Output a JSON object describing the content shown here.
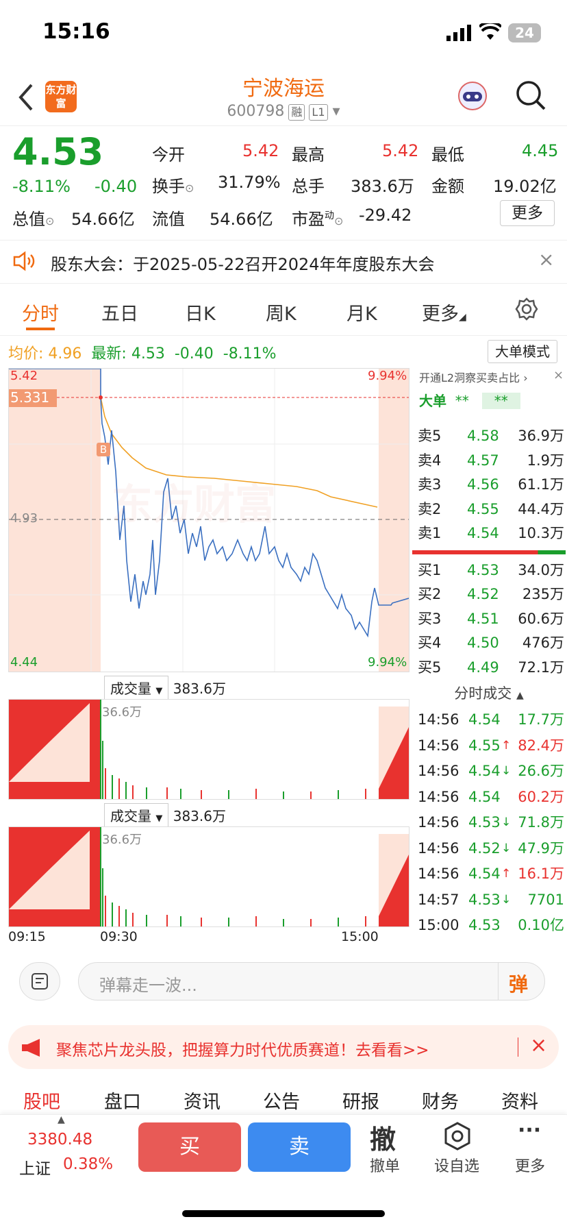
{
  "status": {
    "time": "15:16",
    "battery": "24"
  },
  "header": {
    "title": "宁波海运",
    "code": "600798",
    "tag1": "融",
    "tag2": "L1",
    "logo": "东方财富"
  },
  "quote": {
    "price": "4.53",
    "pct": "-8.11%",
    "chg": "-0.40",
    "open_l": "今开",
    "open": "5.42",
    "high_l": "最高",
    "high": "5.42",
    "low_l": "最低",
    "low": "4.45",
    "turn_l": "换手",
    "turn": "31.79%",
    "vol_l": "总手",
    "vol": "383.6万",
    "amt_l": "金额",
    "amt": "19.02亿",
    "mcap_l": "总值",
    "mcap": "54.66亿",
    "float_l": "流值",
    "float": "54.66亿",
    "pe_l": "市盈",
    "pe_sup": "动",
    "pe": "-29.42",
    "more": "更多"
  },
  "notice": {
    "text": "股东大会：于2025-05-22召开2024年年度股东大会"
  },
  "tabs": [
    "分时",
    "五日",
    "日K",
    "周K",
    "月K",
    "更多"
  ],
  "info": {
    "avg_l": "均价:",
    "avg": "4.96",
    "last_l": "最新:",
    "last": "4.53",
    "chg": "-0.40",
    "pct": "-8.11%",
    "mode": "大单模式"
  },
  "chart": {
    "y_top": "5.42",
    "y_mid": "4.93",
    "y_bot": "4.44",
    "pct_top": "9.94%",
    "pct_bot": "9.94%",
    "ref": "5.331",
    "marker": "B",
    "watermark": "东方财富",
    "x_start": "09:15",
    "x_mid": "09:30",
    "x_end": "15:00"
  },
  "volume": {
    "label": "成交量",
    "total": "383.6万",
    "peak": "36.6万"
  },
  "side": {
    "l2": "开通L2洞察买卖占比",
    "big": "大单",
    "stars1": "**",
    "stars2": "**",
    "asks": [
      {
        "n": "卖5",
        "p": "4.58",
        "v": "36.9万"
      },
      {
        "n": "卖4",
        "p": "4.57",
        "v": "1.9万"
      },
      {
        "n": "卖3",
        "p": "4.56",
        "v": "61.1万"
      },
      {
        "n": "卖2",
        "p": "4.55",
        "v": "44.4万"
      },
      {
        "n": "卖1",
        "p": "4.54",
        "v": "10.3万"
      }
    ],
    "bids": [
      {
        "n": "买1",
        "p": "4.53",
        "v": "34.0万"
      },
      {
        "n": "买2",
        "p": "4.52",
        "v": "235万"
      },
      {
        "n": "买3",
        "p": "4.51",
        "v": "60.6万"
      },
      {
        "n": "买4",
        "p": "4.50",
        "v": "476万"
      },
      {
        "n": "买5",
        "p": "4.49",
        "v": "72.1万"
      }
    ],
    "ticks_title": "分时成交",
    "ticks": [
      {
        "t": "14:56",
        "p": "4.54",
        "a": "",
        "v": "17.7万"
      },
      {
        "t": "14:56",
        "p": "4.55",
        "a": "↑",
        "v": "82.4万"
      },
      {
        "t": "14:56",
        "p": "4.54",
        "a": "↓",
        "v": "26.6万"
      },
      {
        "t": "14:56",
        "p": "4.54",
        "a": "",
        "v": "60.2万"
      },
      {
        "t": "14:56",
        "p": "4.53",
        "a": "↓",
        "v": "71.8万"
      },
      {
        "t": "14:56",
        "p": "4.52",
        "a": "↓",
        "v": "47.9万"
      },
      {
        "t": "14:56",
        "p": "4.54",
        "a": "↑",
        "v": "16.1万"
      },
      {
        "t": "14:57",
        "p": "4.53",
        "a": "↓",
        "v": "7701"
      },
      {
        "t": "15:00",
        "p": "4.53",
        "a": "",
        "v": "0.10亿"
      }
    ]
  },
  "comment": {
    "placeholder": "弹幕走一波...",
    "send": "弹"
  },
  "banner": {
    "text": "聚焦芯片龙头股，把握算力时代优质赛道！去看看>>"
  },
  "nav": [
    "股吧",
    "盘口",
    "资讯",
    "公告",
    "研报",
    "财务",
    "资料"
  ],
  "bottom": {
    "index_val": "3380.48",
    "index_name": "上证",
    "index_pct": "0.38%",
    "buy": "买",
    "sell": "卖",
    "cancel_icon": "撤",
    "cancel": "撤单",
    "watch": "设自选",
    "more": "更多"
  }
}
